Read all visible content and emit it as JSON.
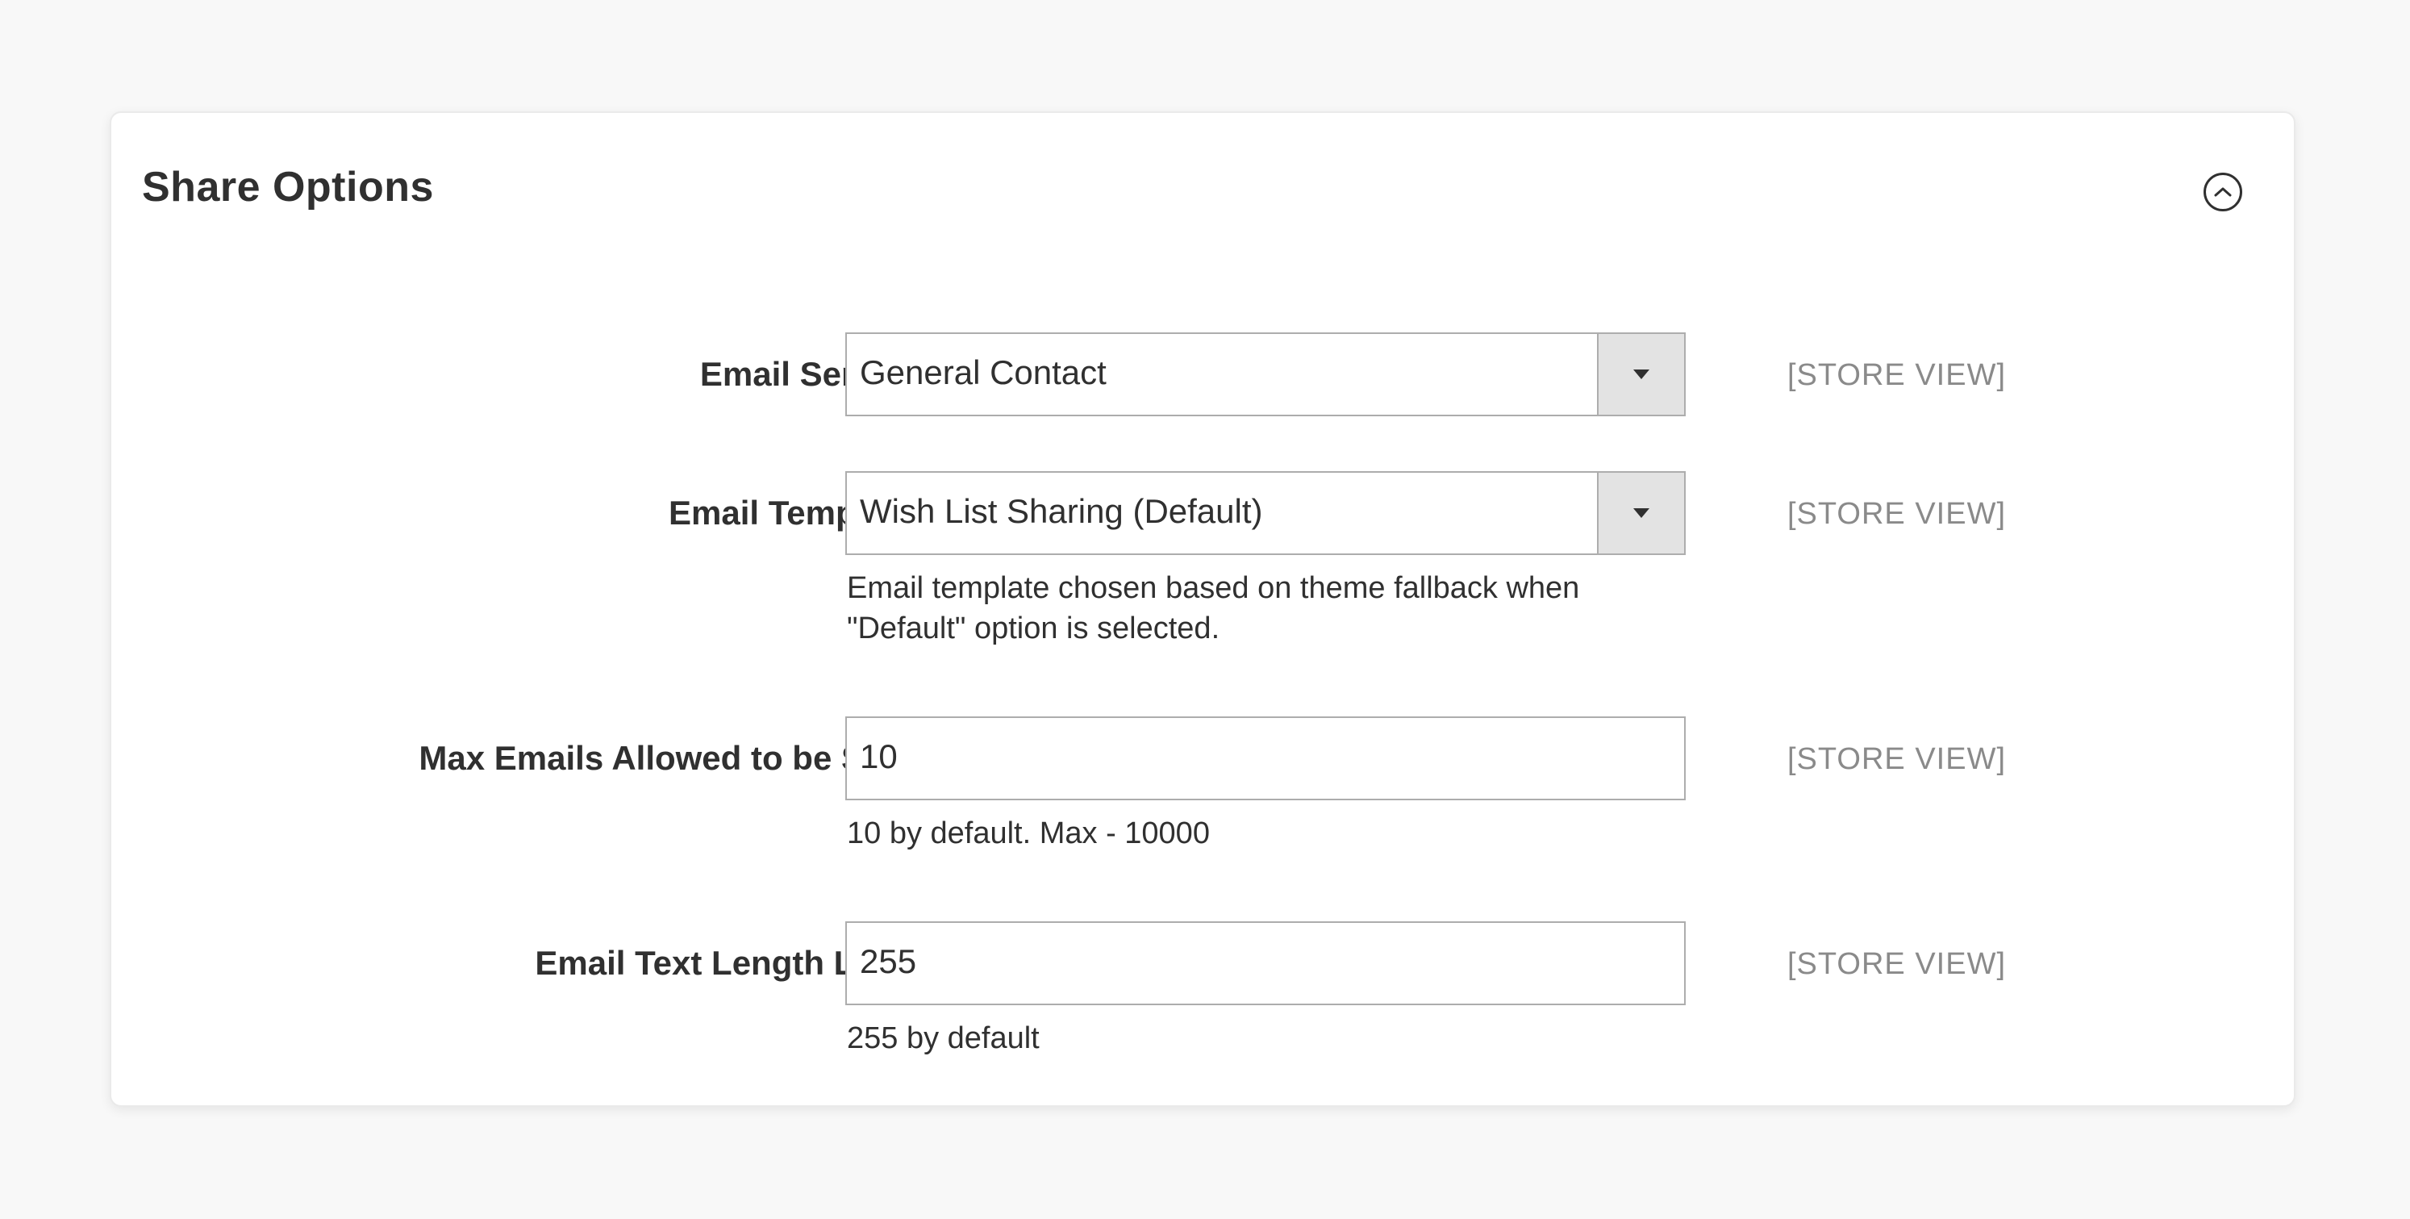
{
  "panel": {
    "title": "Share Options"
  },
  "fields": {
    "email_sender": {
      "label": "Email Sender",
      "value": "General Contact",
      "scope": "[STORE VIEW]"
    },
    "email_template": {
      "label": "Email Template",
      "value": "Wish List Sharing (Default)",
      "scope": "[STORE VIEW]",
      "note_line1": "Email template chosen based on theme fallback when",
      "note_line2": "\"Default\" option is selected."
    },
    "max_emails": {
      "label": "Max Emails Allowed to be Sent",
      "value": "10",
      "scope": "[STORE VIEW]",
      "note": "10 by default. Max - 10000"
    },
    "text_length": {
      "label": "Email Text Length Limit",
      "value": "255",
      "scope": "[STORE VIEW]",
      "note": "255 by default"
    }
  },
  "icons": {
    "collapse": "chevron-up-circle-icon",
    "select_arrow": "caret-down-icon"
  },
  "colors": {
    "background": "#f8f8f8",
    "panel": "#ffffff",
    "text": "#303030",
    "scope": "#8a8a8a",
    "border": "#adadad",
    "select_button": "#e3e3e3"
  }
}
